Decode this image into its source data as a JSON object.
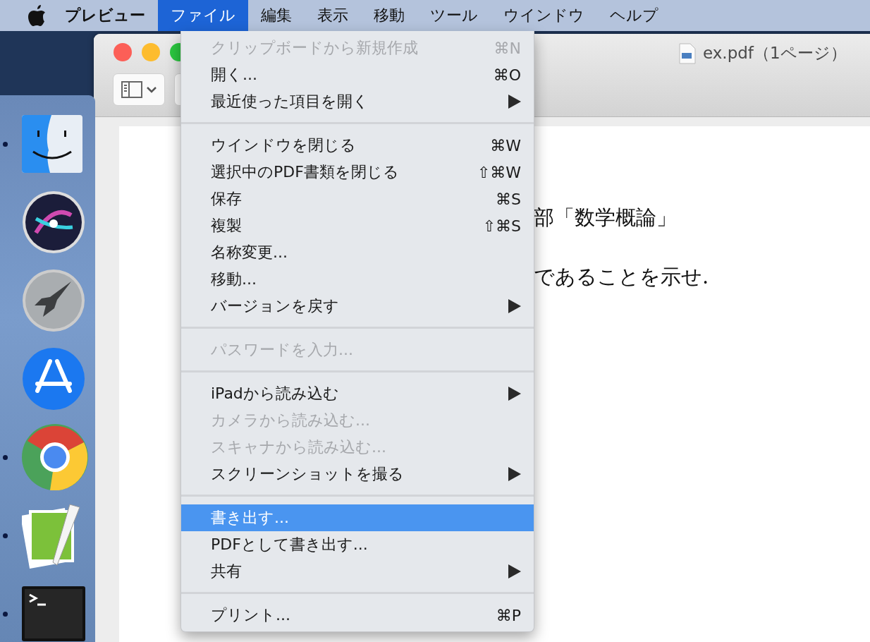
{
  "menu_bar": {
    "app_name": "プレビュー",
    "menus": [
      {
        "label": "ファイル",
        "selected": true
      },
      {
        "label": "編集",
        "selected": false
      },
      {
        "label": "表示",
        "selected": false
      },
      {
        "label": "移動",
        "selected": false
      },
      {
        "label": "ツール",
        "selected": false
      },
      {
        "label": "ウインドウ",
        "selected": false
      },
      {
        "label": "ヘルプ",
        "selected": false
      }
    ]
  },
  "file_menu": {
    "sections": [
      [
        {
          "label": "クリップボードから新規作成",
          "shortcut": "⌘N",
          "disabled": true,
          "selected": false,
          "submenu": false
        },
        {
          "label": "開く...",
          "shortcut": "⌘O",
          "disabled": false,
          "selected": false,
          "submenu": false
        },
        {
          "label": "最近使った項目を開く",
          "disabled": false,
          "selected": false,
          "submenu": true
        }
      ],
      [
        {
          "label": "ウインドウを閉じる",
          "shortcut": "⌘W",
          "disabled": false,
          "selected": false,
          "submenu": false
        },
        {
          "label": "選択中のPDF書類を閉じる",
          "shortcut": "⇧⌘W",
          "disabled": false,
          "selected": false,
          "submenu": false
        },
        {
          "label": "保存",
          "shortcut": "⌘S",
          "disabled": false,
          "selected": false,
          "submenu": false
        },
        {
          "label": "複製",
          "shortcut": "⇧⌘S",
          "disabled": false,
          "selected": false,
          "submenu": false
        },
        {
          "label": "名称変更...",
          "disabled": false,
          "selected": false,
          "submenu": false
        },
        {
          "label": "移動...",
          "disabled": false,
          "selected": false,
          "submenu": false
        },
        {
          "label": "バージョンを戻す",
          "disabled": false,
          "selected": false,
          "submenu": true
        }
      ],
      [
        {
          "label": "パスワードを入力...",
          "disabled": true,
          "selected": false,
          "submenu": false
        }
      ],
      [
        {
          "label": "iPadから読み込む",
          "disabled": false,
          "selected": false,
          "submenu": true
        },
        {
          "label": "カメラから読み込む...",
          "disabled": true,
          "selected": false,
          "submenu": false
        },
        {
          "label": "スキャナから読み込む...",
          "disabled": true,
          "selected": false,
          "submenu": false
        },
        {
          "label": "スクリーンショットを撮る",
          "disabled": false,
          "selected": false,
          "submenu": true
        }
      ],
      [
        {
          "label": "書き出す...",
          "disabled": false,
          "selected": true,
          "submenu": false
        },
        {
          "label": "PDFとして書き出す...",
          "disabled": false,
          "selected": false,
          "submenu": false
        },
        {
          "label": "共有",
          "disabled": false,
          "selected": false,
          "submenu": true
        }
      ],
      [
        {
          "label": "プリント...",
          "shortcut": "⌘P",
          "disabled": false,
          "selected": false,
          "submenu": false
        }
      ]
    ]
  },
  "window": {
    "title": "ex.pdf（1ページ）"
  },
  "document": {
    "lines": [
      "部「数学概論」",
      "であることを示せ."
    ]
  },
  "dock": {
    "items": [
      {
        "kind": "finder",
        "running": true
      },
      {
        "kind": "siri",
        "running": false
      },
      {
        "kind": "launchpad",
        "running": false
      },
      {
        "kind": "appstore",
        "running": false
      },
      {
        "kind": "chrome",
        "running": true
      },
      {
        "kind": "mapeditor",
        "running": true
      },
      {
        "kind": "terminal",
        "running": true
      }
    ]
  }
}
